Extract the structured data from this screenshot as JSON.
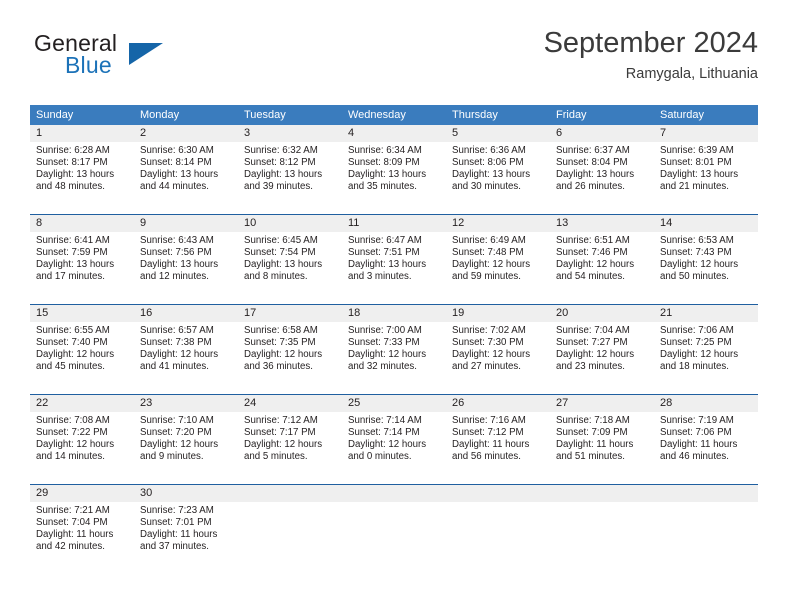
{
  "logo": {
    "word_top": "General",
    "word_bottom": "Blue",
    "triangle_icon": "triangle-icon",
    "accent_color": "#1c72b8"
  },
  "header": {
    "title": "September 2024",
    "subtitle": "Ramygala, Lithuania"
  },
  "theme": {
    "header_blue": "#3a7cbe",
    "row_border_blue": "#1f5fa0",
    "day_band_gray": "#efefef",
    "text_color": "#231f20"
  },
  "calendar": {
    "weekdays": [
      "Sunday",
      "Monday",
      "Tuesday",
      "Wednesday",
      "Thursday",
      "Friday",
      "Saturday"
    ],
    "weeks": [
      [
        {
          "day": "1",
          "sunrise": "Sunrise: 6:28 AM",
          "sunset": "Sunset: 8:17 PM",
          "daylight1": "Daylight: 13 hours",
          "daylight2": "and 48 minutes."
        },
        {
          "day": "2",
          "sunrise": "Sunrise: 6:30 AM",
          "sunset": "Sunset: 8:14 PM",
          "daylight1": "Daylight: 13 hours",
          "daylight2": "and 44 minutes."
        },
        {
          "day": "3",
          "sunrise": "Sunrise: 6:32 AM",
          "sunset": "Sunset: 8:12 PM",
          "daylight1": "Daylight: 13 hours",
          "daylight2": "and 39 minutes."
        },
        {
          "day": "4",
          "sunrise": "Sunrise: 6:34 AM",
          "sunset": "Sunset: 8:09 PM",
          "daylight1": "Daylight: 13 hours",
          "daylight2": "and 35 minutes."
        },
        {
          "day": "5",
          "sunrise": "Sunrise: 6:36 AM",
          "sunset": "Sunset: 8:06 PM",
          "daylight1": "Daylight: 13 hours",
          "daylight2": "and 30 minutes."
        },
        {
          "day": "6",
          "sunrise": "Sunrise: 6:37 AM",
          "sunset": "Sunset: 8:04 PM",
          "daylight1": "Daylight: 13 hours",
          "daylight2": "and 26 minutes."
        },
        {
          "day": "7",
          "sunrise": "Sunrise: 6:39 AM",
          "sunset": "Sunset: 8:01 PM",
          "daylight1": "Daylight: 13 hours",
          "daylight2": "and 21 minutes."
        }
      ],
      [
        {
          "day": "8",
          "sunrise": "Sunrise: 6:41 AM",
          "sunset": "Sunset: 7:59 PM",
          "daylight1": "Daylight: 13 hours",
          "daylight2": "and 17 minutes."
        },
        {
          "day": "9",
          "sunrise": "Sunrise: 6:43 AM",
          "sunset": "Sunset: 7:56 PM",
          "daylight1": "Daylight: 13 hours",
          "daylight2": "and 12 minutes."
        },
        {
          "day": "10",
          "sunrise": "Sunrise: 6:45 AM",
          "sunset": "Sunset: 7:54 PM",
          "daylight1": "Daylight: 13 hours",
          "daylight2": "and 8 minutes."
        },
        {
          "day": "11",
          "sunrise": "Sunrise: 6:47 AM",
          "sunset": "Sunset: 7:51 PM",
          "daylight1": "Daylight: 13 hours",
          "daylight2": "and 3 minutes."
        },
        {
          "day": "12",
          "sunrise": "Sunrise: 6:49 AM",
          "sunset": "Sunset: 7:48 PM",
          "daylight1": "Daylight: 12 hours",
          "daylight2": "and 59 minutes."
        },
        {
          "day": "13",
          "sunrise": "Sunrise: 6:51 AM",
          "sunset": "Sunset: 7:46 PM",
          "daylight1": "Daylight: 12 hours",
          "daylight2": "and 54 minutes."
        },
        {
          "day": "14",
          "sunrise": "Sunrise: 6:53 AM",
          "sunset": "Sunset: 7:43 PM",
          "daylight1": "Daylight: 12 hours",
          "daylight2": "and 50 minutes."
        }
      ],
      [
        {
          "day": "15",
          "sunrise": "Sunrise: 6:55 AM",
          "sunset": "Sunset: 7:40 PM",
          "daylight1": "Daylight: 12 hours",
          "daylight2": "and 45 minutes."
        },
        {
          "day": "16",
          "sunrise": "Sunrise: 6:57 AM",
          "sunset": "Sunset: 7:38 PM",
          "daylight1": "Daylight: 12 hours",
          "daylight2": "and 41 minutes."
        },
        {
          "day": "17",
          "sunrise": "Sunrise: 6:58 AM",
          "sunset": "Sunset: 7:35 PM",
          "daylight1": "Daylight: 12 hours",
          "daylight2": "and 36 minutes."
        },
        {
          "day": "18",
          "sunrise": "Sunrise: 7:00 AM",
          "sunset": "Sunset: 7:33 PM",
          "daylight1": "Daylight: 12 hours",
          "daylight2": "and 32 minutes."
        },
        {
          "day": "19",
          "sunrise": "Sunrise: 7:02 AM",
          "sunset": "Sunset: 7:30 PM",
          "daylight1": "Daylight: 12 hours",
          "daylight2": "and 27 minutes."
        },
        {
          "day": "20",
          "sunrise": "Sunrise: 7:04 AM",
          "sunset": "Sunset: 7:27 PM",
          "daylight1": "Daylight: 12 hours",
          "daylight2": "and 23 minutes."
        },
        {
          "day": "21",
          "sunrise": "Sunrise: 7:06 AM",
          "sunset": "Sunset: 7:25 PM",
          "daylight1": "Daylight: 12 hours",
          "daylight2": "and 18 minutes."
        }
      ],
      [
        {
          "day": "22",
          "sunrise": "Sunrise: 7:08 AM",
          "sunset": "Sunset: 7:22 PM",
          "daylight1": "Daylight: 12 hours",
          "daylight2": "and 14 minutes."
        },
        {
          "day": "23",
          "sunrise": "Sunrise: 7:10 AM",
          "sunset": "Sunset: 7:20 PM",
          "daylight1": "Daylight: 12 hours",
          "daylight2": "and 9 minutes."
        },
        {
          "day": "24",
          "sunrise": "Sunrise: 7:12 AM",
          "sunset": "Sunset: 7:17 PM",
          "daylight1": "Daylight: 12 hours",
          "daylight2": "and 5 minutes."
        },
        {
          "day": "25",
          "sunrise": "Sunrise: 7:14 AM",
          "sunset": "Sunset: 7:14 PM",
          "daylight1": "Daylight: 12 hours",
          "daylight2": "and 0 minutes."
        },
        {
          "day": "26",
          "sunrise": "Sunrise: 7:16 AM",
          "sunset": "Sunset: 7:12 PM",
          "daylight1": "Daylight: 11 hours",
          "daylight2": "and 56 minutes."
        },
        {
          "day": "27",
          "sunrise": "Sunrise: 7:18 AM",
          "sunset": "Sunset: 7:09 PM",
          "daylight1": "Daylight: 11 hours",
          "daylight2": "and 51 minutes."
        },
        {
          "day": "28",
          "sunrise": "Sunrise: 7:19 AM",
          "sunset": "Sunset: 7:06 PM",
          "daylight1": "Daylight: 11 hours",
          "daylight2": "and 46 minutes."
        }
      ],
      [
        {
          "day": "29",
          "sunrise": "Sunrise: 7:21 AM",
          "sunset": "Sunset: 7:04 PM",
          "daylight1": "Daylight: 11 hours",
          "daylight2": "and 42 minutes."
        },
        {
          "day": "30",
          "sunrise": "Sunrise: 7:23 AM",
          "sunset": "Sunset: 7:01 PM",
          "daylight1": "Daylight: 11 hours",
          "daylight2": "and 37 minutes."
        },
        {
          "day": "",
          "sunrise": "",
          "sunset": "",
          "daylight1": "",
          "daylight2": ""
        },
        {
          "day": "",
          "sunrise": "",
          "sunset": "",
          "daylight1": "",
          "daylight2": ""
        },
        {
          "day": "",
          "sunrise": "",
          "sunset": "",
          "daylight1": "",
          "daylight2": ""
        },
        {
          "day": "",
          "sunrise": "",
          "sunset": "",
          "daylight1": "",
          "daylight2": ""
        },
        {
          "day": "",
          "sunrise": "",
          "sunset": "",
          "daylight1": "",
          "daylight2": ""
        }
      ]
    ]
  }
}
